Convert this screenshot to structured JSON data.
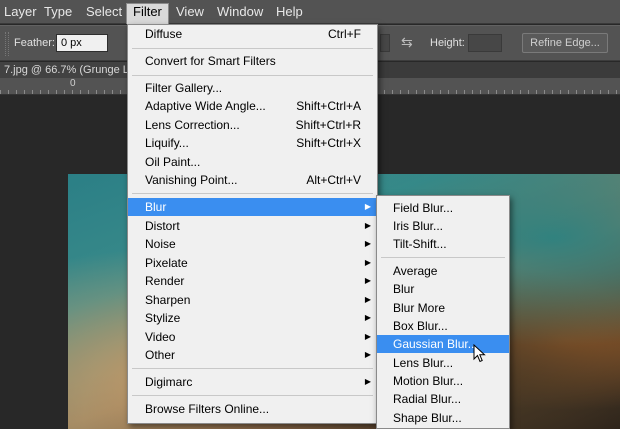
{
  "menubar": {
    "items": [
      {
        "label": "Layer"
      },
      {
        "label": "Type"
      },
      {
        "label": "Select"
      },
      {
        "label": "Filter",
        "active": true
      },
      {
        "label": "View"
      },
      {
        "label": "Window"
      },
      {
        "label": "Help"
      }
    ]
  },
  "options": {
    "feather_label": "Feather:",
    "feather_value": "0 px",
    "height_label": "Height:",
    "refine_label": "Refine Edge..."
  },
  "document": {
    "tab_title": "7.jpg @ 66.7% (Grunge La"
  },
  "ruler": {
    "zero": "0"
  },
  "filter_menu": {
    "items": [
      {
        "label": "Diffuse",
        "shortcut": "Ctrl+F"
      },
      {
        "label": "Convert for Smart Filters"
      },
      {
        "label": "Filter Gallery..."
      },
      {
        "label": "Adaptive Wide Angle...",
        "shortcut": "Shift+Ctrl+A"
      },
      {
        "label": "Lens Correction...",
        "shortcut": "Shift+Ctrl+R"
      },
      {
        "label": "Liquify...",
        "shortcut": "Shift+Ctrl+X"
      },
      {
        "label": "Oil Paint..."
      },
      {
        "label": "Vanishing Point...",
        "shortcut": "Alt+Ctrl+V"
      },
      {
        "label": "Blur",
        "submenu": true,
        "highlighted": true
      },
      {
        "label": "Distort",
        "submenu": true
      },
      {
        "label": "Noise",
        "submenu": true
      },
      {
        "label": "Pixelate",
        "submenu": true
      },
      {
        "label": "Render",
        "submenu": true
      },
      {
        "label": "Sharpen",
        "submenu": true
      },
      {
        "label": "Stylize",
        "submenu": true
      },
      {
        "label": "Video",
        "submenu": true
      },
      {
        "label": "Other",
        "submenu": true
      },
      {
        "label": "Digimarc",
        "submenu": true
      },
      {
        "label": "Browse Filters Online..."
      }
    ]
  },
  "blur_menu": {
    "items": [
      {
        "label": "Field Blur..."
      },
      {
        "label": "Iris Blur..."
      },
      {
        "label": "Tilt-Shift..."
      },
      {
        "label": "Average"
      },
      {
        "label": "Blur"
      },
      {
        "label": "Blur More"
      },
      {
        "label": "Box Blur..."
      },
      {
        "label": "Gaussian Blur...",
        "highlighted": true
      },
      {
        "label": "Lens Blur..."
      },
      {
        "label": "Motion Blur..."
      },
      {
        "label": "Radial Blur..."
      },
      {
        "label": "Shape Blur..."
      }
    ]
  },
  "icons": {
    "submenu_arrow": "triangle-right-icon",
    "swap": "swap-arrows-icon",
    "cursor": "mouse-pointer-icon"
  },
  "colors": {
    "highlight": "#3a8ef0",
    "menu_bg": "#f0f0f0",
    "chrome": "#535353"
  }
}
